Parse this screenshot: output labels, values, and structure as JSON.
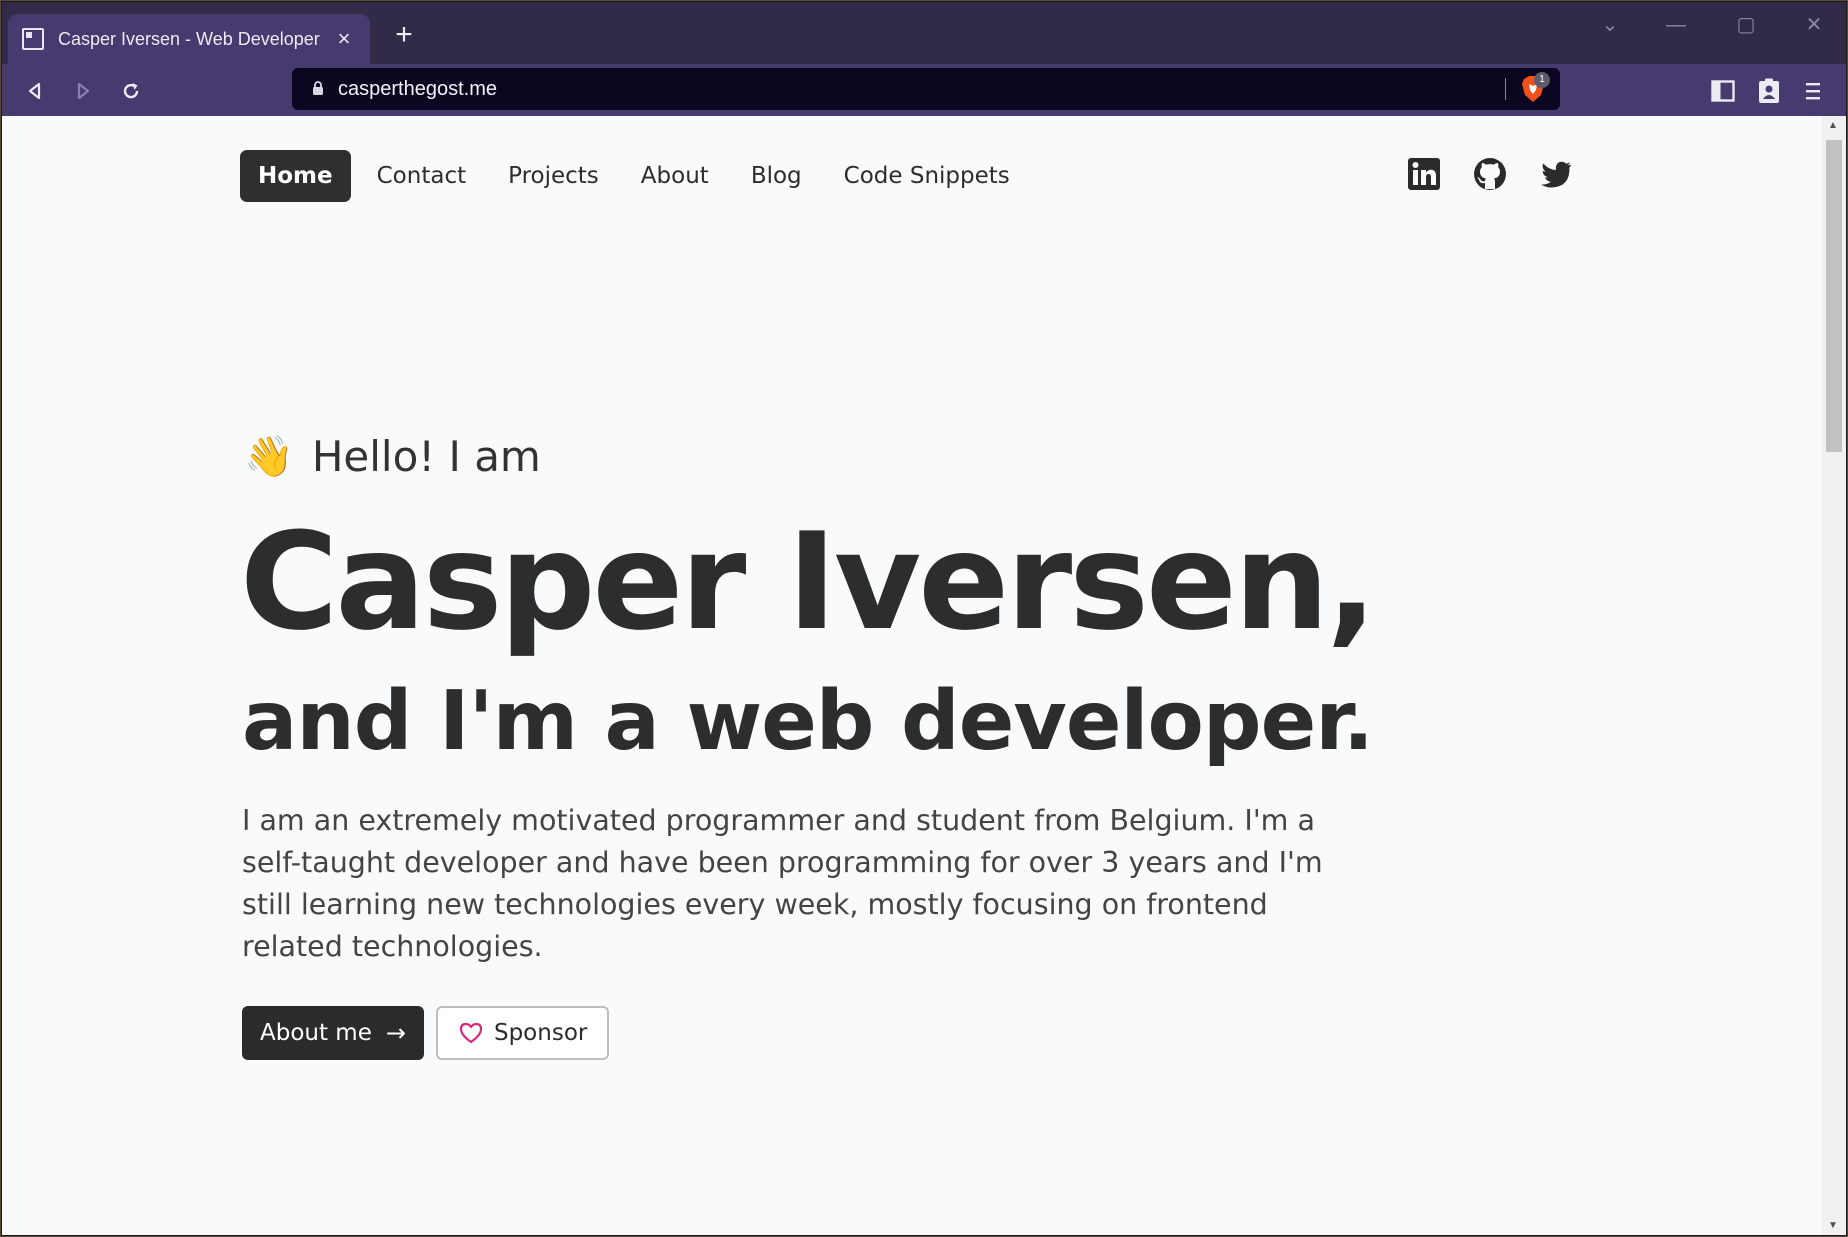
{
  "browser": {
    "tab_title": "Casper Iversen - Web Developer",
    "tab_close": "×",
    "new_tab": "+",
    "url": "casperthegost.me",
    "shields_count": "1",
    "window_controls": {
      "dropdown": "⌄",
      "minimize": "—",
      "maximize": "▢",
      "close": "✕"
    }
  },
  "site": {
    "nav": [
      "Home",
      "Contact",
      "Projects",
      "About",
      "Blog",
      "Code Snippets"
    ],
    "active_nav": "Home",
    "socials": [
      "linkedin-icon",
      "github-icon",
      "twitter-icon"
    ],
    "hero": {
      "wave": "👋",
      "greeting": "Hello! I am",
      "name": "Casper Iversen,",
      "role": "and I'm a web developer.",
      "bio": "I am an extremely motivated programmer and student from Belgium. I'm a self-taught developer and have been programming for over 3 years and I'm still learning new technologies every week, mostly focusing on frontend related technologies.",
      "primary_button": "About me",
      "primary_arrow": "→",
      "secondary_button": "Sponsor"
    }
  },
  "colors": {
    "tabstrip": "#322b48",
    "toolbar": "#463a6e",
    "page_bg": "#f9fafb",
    "text_dark": "#2d2d2d",
    "heart": "#db2777"
  }
}
